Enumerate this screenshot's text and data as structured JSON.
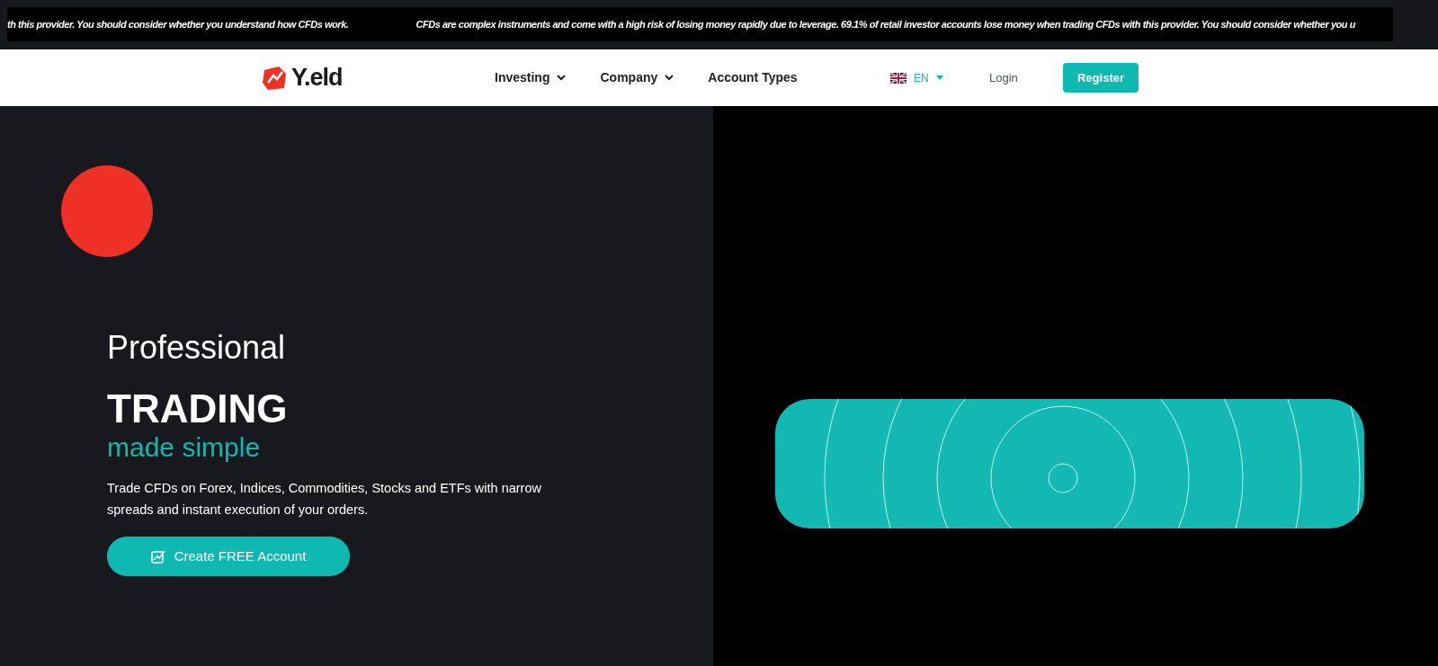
{
  "risk_ticker": [
    "th this provider. You should consider whether you understand how CFDs work.",
    "CFDs are complex instruments and come with a high risk of losing money rapidly due to leverage. 69.1% of retail investor accounts lose money when trading CFDs with this provider. You should consider whether you u"
  ],
  "nav": {
    "logo": "Y.eld",
    "links": [
      {
        "label": "Investing",
        "dropdown": true
      },
      {
        "label": "Company",
        "dropdown": true
      },
      {
        "label": "Account Types",
        "dropdown": false
      }
    ],
    "language": "EN",
    "login": "Login",
    "register": "Register"
  },
  "hero": {
    "kicker": "Professional",
    "title": "TRADING",
    "subtitle": "made simple",
    "description": "Trade CFDs on Forex, Indices, Commodities, Stocks and ETFs with narrow spreads and instant execution of your orders.",
    "cta": "Create FREE Account"
  }
}
